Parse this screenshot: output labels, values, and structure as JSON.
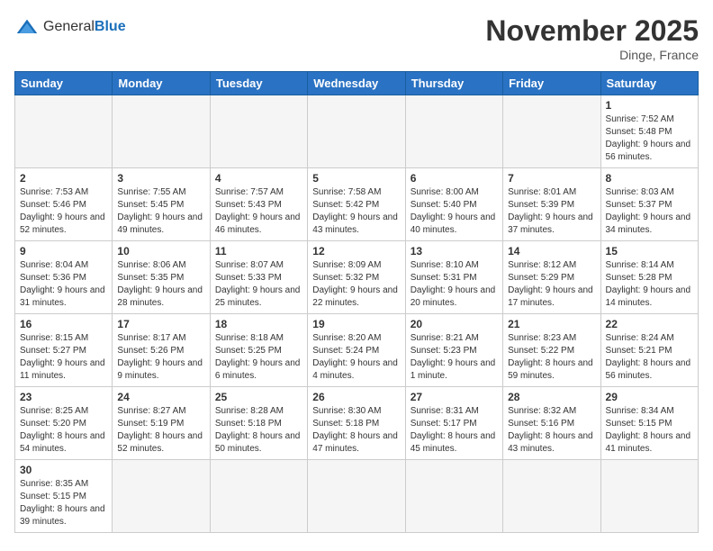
{
  "logo": {
    "general": "General",
    "blue": "Blue"
  },
  "title": "November 2025",
  "location": "Dinge, France",
  "weekdays": [
    "Sunday",
    "Monday",
    "Tuesday",
    "Wednesday",
    "Thursday",
    "Friday",
    "Saturday"
  ],
  "days": [
    {
      "num": "",
      "info": ""
    },
    {
      "num": "",
      "info": ""
    },
    {
      "num": "",
      "info": ""
    },
    {
      "num": "",
      "info": ""
    },
    {
      "num": "",
      "info": ""
    },
    {
      "num": "",
      "info": ""
    },
    {
      "num": "1",
      "info": "Sunrise: 7:52 AM\nSunset: 5:48 PM\nDaylight: 9 hours and 56 minutes."
    },
    {
      "num": "2",
      "info": "Sunrise: 7:53 AM\nSunset: 5:46 PM\nDaylight: 9 hours and 52 minutes."
    },
    {
      "num": "3",
      "info": "Sunrise: 7:55 AM\nSunset: 5:45 PM\nDaylight: 9 hours and 49 minutes."
    },
    {
      "num": "4",
      "info": "Sunrise: 7:57 AM\nSunset: 5:43 PM\nDaylight: 9 hours and 46 minutes."
    },
    {
      "num": "5",
      "info": "Sunrise: 7:58 AM\nSunset: 5:42 PM\nDaylight: 9 hours and 43 minutes."
    },
    {
      "num": "6",
      "info": "Sunrise: 8:00 AM\nSunset: 5:40 PM\nDaylight: 9 hours and 40 minutes."
    },
    {
      "num": "7",
      "info": "Sunrise: 8:01 AM\nSunset: 5:39 PM\nDaylight: 9 hours and 37 minutes."
    },
    {
      "num": "8",
      "info": "Sunrise: 8:03 AM\nSunset: 5:37 PM\nDaylight: 9 hours and 34 minutes."
    },
    {
      "num": "9",
      "info": "Sunrise: 8:04 AM\nSunset: 5:36 PM\nDaylight: 9 hours and 31 minutes."
    },
    {
      "num": "10",
      "info": "Sunrise: 8:06 AM\nSunset: 5:35 PM\nDaylight: 9 hours and 28 minutes."
    },
    {
      "num": "11",
      "info": "Sunrise: 8:07 AM\nSunset: 5:33 PM\nDaylight: 9 hours and 25 minutes."
    },
    {
      "num": "12",
      "info": "Sunrise: 8:09 AM\nSunset: 5:32 PM\nDaylight: 9 hours and 22 minutes."
    },
    {
      "num": "13",
      "info": "Sunrise: 8:10 AM\nSunset: 5:31 PM\nDaylight: 9 hours and 20 minutes."
    },
    {
      "num": "14",
      "info": "Sunrise: 8:12 AM\nSunset: 5:29 PM\nDaylight: 9 hours and 17 minutes."
    },
    {
      "num": "15",
      "info": "Sunrise: 8:14 AM\nSunset: 5:28 PM\nDaylight: 9 hours and 14 minutes."
    },
    {
      "num": "16",
      "info": "Sunrise: 8:15 AM\nSunset: 5:27 PM\nDaylight: 9 hours and 11 minutes."
    },
    {
      "num": "17",
      "info": "Sunrise: 8:17 AM\nSunset: 5:26 PM\nDaylight: 9 hours and 9 minutes."
    },
    {
      "num": "18",
      "info": "Sunrise: 8:18 AM\nSunset: 5:25 PM\nDaylight: 9 hours and 6 minutes."
    },
    {
      "num": "19",
      "info": "Sunrise: 8:20 AM\nSunset: 5:24 PM\nDaylight: 9 hours and 4 minutes."
    },
    {
      "num": "20",
      "info": "Sunrise: 8:21 AM\nSunset: 5:23 PM\nDaylight: 9 hours and 1 minute."
    },
    {
      "num": "21",
      "info": "Sunrise: 8:23 AM\nSunset: 5:22 PM\nDaylight: 8 hours and 59 minutes."
    },
    {
      "num": "22",
      "info": "Sunrise: 8:24 AM\nSunset: 5:21 PM\nDaylight: 8 hours and 56 minutes."
    },
    {
      "num": "23",
      "info": "Sunrise: 8:25 AM\nSunset: 5:20 PM\nDaylight: 8 hours and 54 minutes."
    },
    {
      "num": "24",
      "info": "Sunrise: 8:27 AM\nSunset: 5:19 PM\nDaylight: 8 hours and 52 minutes."
    },
    {
      "num": "25",
      "info": "Sunrise: 8:28 AM\nSunset: 5:18 PM\nDaylight: 8 hours and 50 minutes."
    },
    {
      "num": "26",
      "info": "Sunrise: 8:30 AM\nSunset: 5:18 PM\nDaylight: 8 hours and 47 minutes."
    },
    {
      "num": "27",
      "info": "Sunrise: 8:31 AM\nSunset: 5:17 PM\nDaylight: 8 hours and 45 minutes."
    },
    {
      "num": "28",
      "info": "Sunrise: 8:32 AM\nSunset: 5:16 PM\nDaylight: 8 hours and 43 minutes."
    },
    {
      "num": "29",
      "info": "Sunrise: 8:34 AM\nSunset: 5:15 PM\nDaylight: 8 hours and 41 minutes."
    },
    {
      "num": "30",
      "info": "Sunrise: 8:35 AM\nSunset: 5:15 PM\nDaylight: 8 hours and 39 minutes."
    },
    {
      "num": "",
      "info": ""
    },
    {
      "num": "",
      "info": ""
    },
    {
      "num": "",
      "info": ""
    },
    {
      "num": "",
      "info": ""
    },
    {
      "num": "",
      "info": ""
    },
    {
      "num": "",
      "info": ""
    }
  ]
}
